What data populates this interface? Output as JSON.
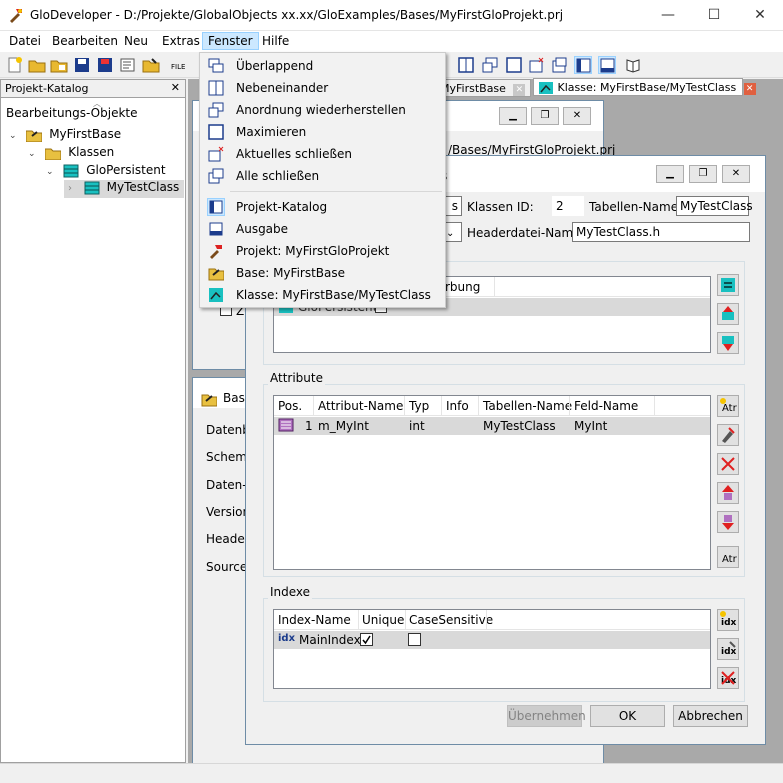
{
  "window": {
    "title": "GloDeveloper - D:/Projekte/GlobalObjects xx.xx/GloExamples/Bases/MyFirstGloProjekt.prj",
    "minimize": "—",
    "maximize": "☐",
    "close": "✕"
  },
  "menu": {
    "items": [
      "Datei",
      "Bearbeiten",
      "Neu",
      "Extras",
      "Fenster",
      "Hilfe"
    ]
  },
  "fenster_menu": {
    "items": [
      {
        "label": "Überlappend",
        "icon": "cascade-icon"
      },
      {
        "label": "Nebeneinander",
        "icon": "tile-icon"
      },
      {
        "label": "Anordnung wiederherstellen",
        "icon": "restore-layout-icon"
      },
      {
        "label": "Maximieren",
        "icon": "maximize-window-icon"
      },
      {
        "label": "Aktuelles schließen",
        "icon": "close-current-icon"
      },
      {
        "label": "Alle schließen",
        "icon": "close-all-icon"
      }
    ],
    "items2": [
      {
        "label": "Projekt-Katalog",
        "icon": "project-catalog-icon"
      },
      {
        "label": "Ausgabe",
        "icon": "output-icon"
      },
      {
        "label": "Projekt: MyFirstGloProjekt",
        "icon": "project-icon"
      },
      {
        "label": "Base: MyFirstBase",
        "icon": "base-icon"
      },
      {
        "label": "Klasse: MyFirstBase/MyTestClass",
        "icon": "class-icon"
      }
    ]
  },
  "catalog": {
    "header": "Projekt-Katalog",
    "close": "✕",
    "section": "Bearbeitungs-Objekte",
    "tree": [
      "MyFirstBase",
      "Klassen",
      "GloPersistent",
      "MyTestClass"
    ]
  },
  "tabs": {
    "base_tab": "MyFirstBase",
    "class_tab": "Klasse: MyFirstBase/MyTestClass"
  },
  "project_window": {
    "path_fragment": "/Bases/MyFirstGloProjekt.prj"
  },
  "base_window": {
    "title": "Base",
    "labels": [
      "Datenba",
      "Schema",
      "Daten-U",
      "Version:",
      "Header-",
      "Source-"
    ]
  },
  "class_window": {
    "title_fragment": "s",
    "field_fragment": "s",
    "klassen_id_label": "Klassen ID:",
    "klassen_id": "2",
    "tabellen_name_label": "Tabellen-Name :",
    "tabellen_name": "MyTestClass",
    "headerdatei_label": "Headerdatei-Name :",
    "headerdatei": "MyTestClass.h",
    "superclass_col_fragment": "rbung",
    "superclass_row": "GloPersistent",
    "attribute_group": "Attribute",
    "attribute_cols": [
      "Pos.",
      "Attribut-Name",
      "Typ",
      "Info",
      "Tabellen-Name",
      "Feld-Name"
    ],
    "attribute_rows": [
      [
        "1",
        "m_MyInt",
        "int",
        "",
        "MyTestClass",
        "MyInt"
      ]
    ],
    "index_group": "Indexe",
    "index_cols": [
      "Index-Name",
      "Unique",
      "CaseSensitive"
    ],
    "index_rows": [
      {
        "name": "MainIndex",
        "unique": true,
        "case_sensitive": false
      }
    ],
    "buttons": {
      "apply": "Übernehmen",
      "ok": "OK",
      "cancel": "Abbrechen"
    }
  }
}
